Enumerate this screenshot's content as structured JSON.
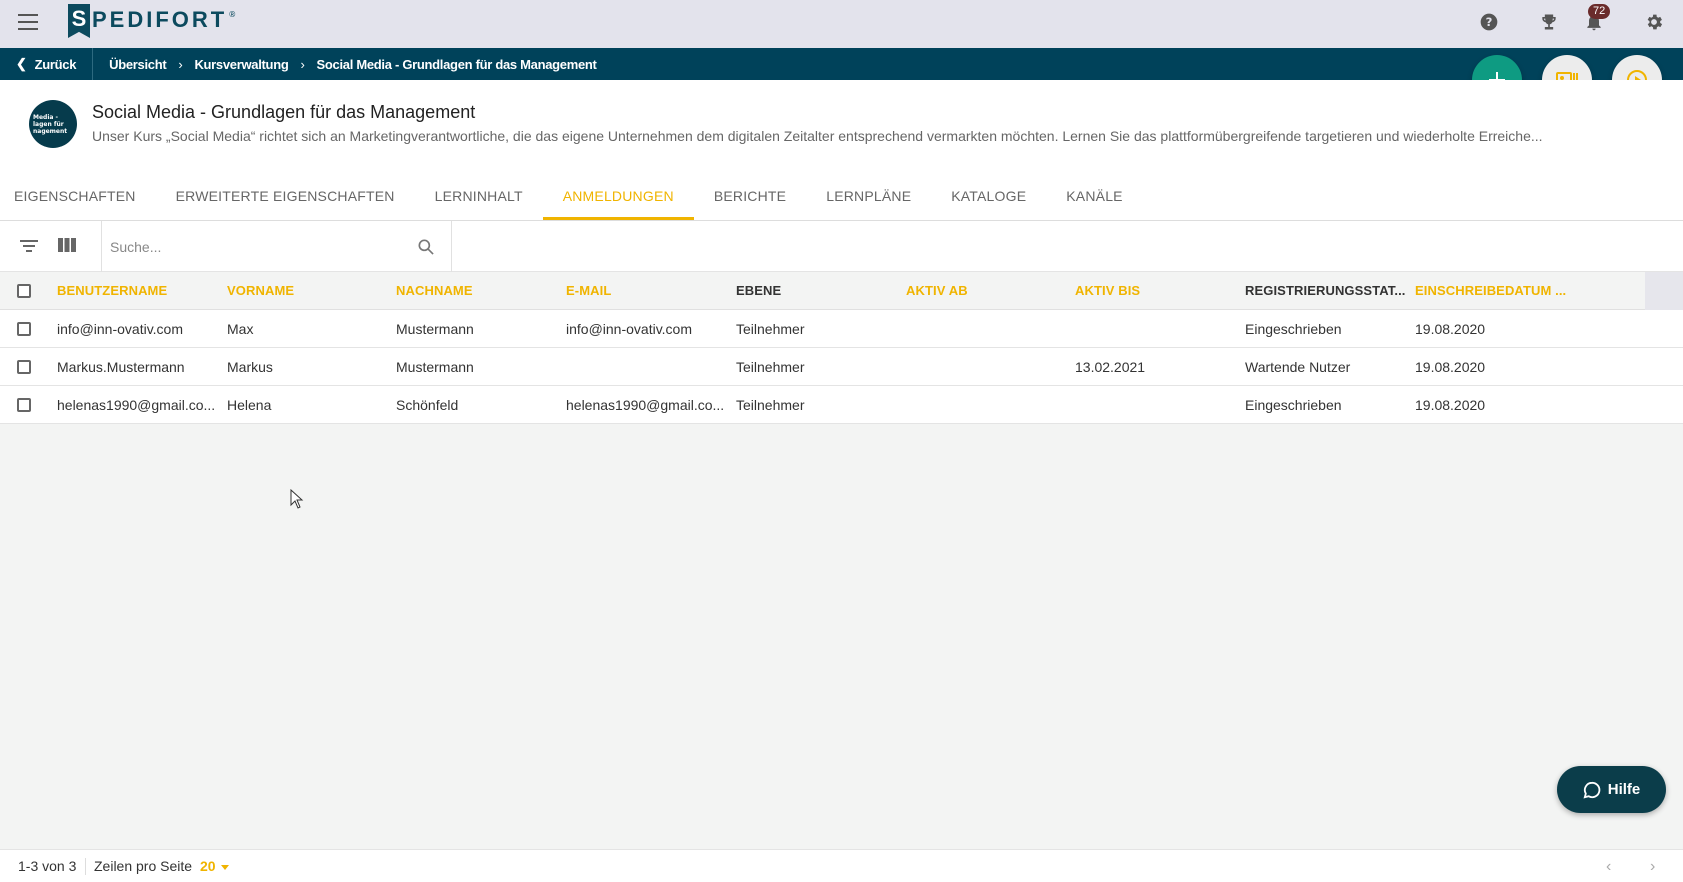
{
  "header": {
    "logo_initial": "S",
    "logo_text": "PEDIFORT",
    "logo_reg": "®",
    "notification_count": "72"
  },
  "breadcrumb": {
    "back_label": "Zurück",
    "items": [
      "Übersicht",
      "Kursverwaltung",
      "Social Media - Grundlagen für das Management"
    ]
  },
  "course": {
    "avatar_lines": [
      "Media -",
      "lagen für",
      "nagement"
    ],
    "title": "Social Media - Grundlagen für das Management",
    "description": "Unser Kurs „Social Media“ richtet sich an Marketingverantwortliche, die das eigene Unternehmen dem digitalen Zeitalter entsprechend vermarkten möchten. Lernen Sie das plattformübergreifende targetieren und wiederholte Erreiche..."
  },
  "tabs": [
    {
      "label": "EIGENSCHAFTEN",
      "active": false
    },
    {
      "label": "ERWEITERTE EIGENSCHAFTEN",
      "active": false
    },
    {
      "label": "LERNINHALT",
      "active": false
    },
    {
      "label": "ANMELDUNGEN",
      "active": true
    },
    {
      "label": "BERICHTE",
      "active": false
    },
    {
      "label": "LERNPLÄNE",
      "active": false
    },
    {
      "label": "KATALOGE",
      "active": false
    },
    {
      "label": "KANÄLE",
      "active": false
    }
  ],
  "search": {
    "placeholder": "Suche..."
  },
  "table": {
    "columns": [
      "BENUTZERNAME",
      "VORNAME",
      "NACHNAME",
      "E-MAIL",
      "EBENE",
      "AKTIV AB",
      "AKTIV BIS",
      "REGISTRIERUNGSSTAT...",
      "EINSCHREIBEDATUM ..."
    ],
    "rows": [
      [
        "info@inn-ovativ.com",
        "Max",
        "Mustermann",
        "info@inn-ovativ.com",
        "Teilnehmer",
        "",
        "",
        "Eingeschrieben",
        "19.08.2020"
      ],
      [
        "Markus.Mustermann",
        "Markus",
        "Mustermann",
        "",
        "Teilnehmer",
        "",
        "13.02.2021",
        "Wartende Nutzer",
        "19.08.2020"
      ],
      [
        "helenas1990@gmail.co...",
        "Helena",
        "Schönfeld",
        "helenas1990@gmail.co...",
        "Teilnehmer",
        "",
        "",
        "Eingeschrieben",
        "19.08.2020"
      ]
    ]
  },
  "footer": {
    "count": "1-3 von 3",
    "rows_per_page_label": "Zeilen pro Seite",
    "rows_per_page_value": "20"
  },
  "help": {
    "label": "Hilfe"
  },
  "colors": {
    "accent": "#f0b400",
    "primary_dark": "#00425a",
    "fab_green": "#0e9b82"
  }
}
